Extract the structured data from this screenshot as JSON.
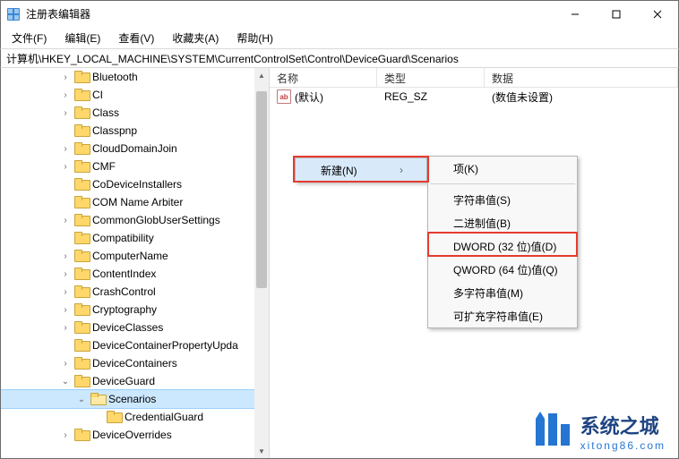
{
  "window": {
    "title": "注册表编辑器"
  },
  "menus": {
    "file": "文件(F)",
    "edit": "编辑(E)",
    "view": "查看(V)",
    "fav": "收藏夹(A)",
    "help": "帮助(H)"
  },
  "address": "计算机\\HKEY_LOCAL_MACHINE\\SYSTEM\\CurrentControlSet\\Control\\DeviceGuard\\Scenarios",
  "columns": {
    "name": "名称",
    "type": "类型",
    "data": "数据"
  },
  "list_rows": [
    {
      "icon": "ab",
      "name": "(默认)",
      "type": "REG_SZ",
      "data": "(数值未设置)"
    }
  ],
  "tree": {
    "indent_base": 66,
    "items": [
      {
        "label": "Bluetooth",
        "twisty": ">",
        "depth": 0
      },
      {
        "label": "CI",
        "twisty": ">",
        "depth": 0
      },
      {
        "label": "Class",
        "twisty": ">",
        "depth": 0
      },
      {
        "label": "Classpnp",
        "twisty": "",
        "depth": 0
      },
      {
        "label": "CloudDomainJoin",
        "twisty": ">",
        "depth": 0
      },
      {
        "label": "CMF",
        "twisty": ">",
        "depth": 0
      },
      {
        "label": "CoDeviceInstallers",
        "twisty": "",
        "depth": 0
      },
      {
        "label": "COM Name Arbiter",
        "twisty": "",
        "depth": 0
      },
      {
        "label": "CommonGlobUserSettings",
        "twisty": ">",
        "depth": 0
      },
      {
        "label": "Compatibility",
        "twisty": "",
        "depth": 0
      },
      {
        "label": "ComputerName",
        "twisty": ">",
        "depth": 0
      },
      {
        "label": "ContentIndex",
        "twisty": ">",
        "depth": 0
      },
      {
        "label": "CrashControl",
        "twisty": ">",
        "depth": 0
      },
      {
        "label": "Cryptography",
        "twisty": ">",
        "depth": 0
      },
      {
        "label": "DeviceClasses",
        "twisty": ">",
        "depth": 0
      },
      {
        "label": "DeviceContainerPropertyUpda",
        "twisty": "",
        "depth": 0
      },
      {
        "label": "DeviceContainers",
        "twisty": ">",
        "depth": 0
      },
      {
        "label": "DeviceGuard",
        "twisty": "v",
        "depth": 0
      },
      {
        "label": "Scenarios",
        "twisty": "v",
        "depth": 1,
        "selected": true,
        "open": true
      },
      {
        "label": "CredentialGuard",
        "twisty": "",
        "depth": 2
      },
      {
        "label": "DeviceOverrides",
        "twisty": ">",
        "depth": 0
      }
    ]
  },
  "context_primary": {
    "new": "新建(N)"
  },
  "context_sub": {
    "key": "项(K)",
    "string": "字符串值(S)",
    "binary": "二进制值(B)",
    "dword": "DWORD (32 位)值(D)",
    "qword": "QWORD (64 位)值(Q)",
    "multi": "多字符串值(M)",
    "expand": "可扩充字符串值(E)"
  },
  "watermark": {
    "main": "系统之城",
    "sub": "xitong86.com"
  }
}
